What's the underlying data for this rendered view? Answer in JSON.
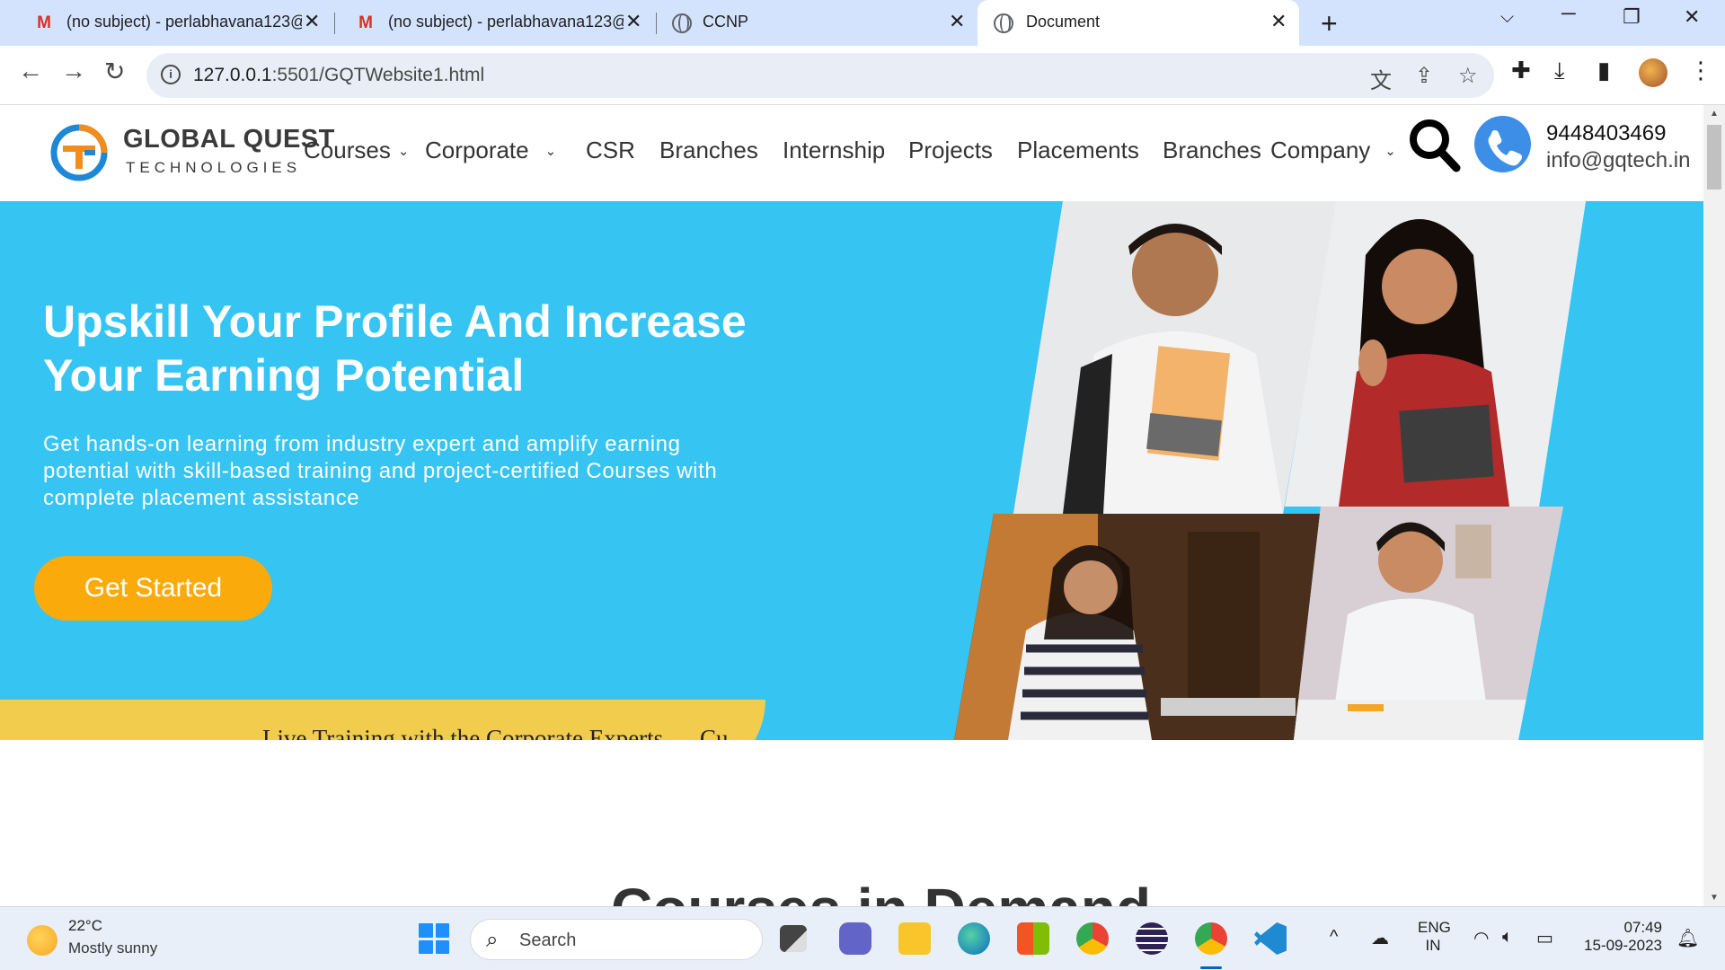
{
  "browser": {
    "tabs": [
      {
        "icon": "gmail-icon",
        "title": "(no subject) - perlabhavana123@",
        "active": false
      },
      {
        "icon": "gmail-icon",
        "title": "(no subject) - perlabhavana123@",
        "active": false
      },
      {
        "icon": "globe-icon",
        "title": "CCNP",
        "active": false
      },
      {
        "icon": "globe-icon",
        "title": "Document",
        "active": true
      }
    ],
    "url_host": "127.0.0.1",
    "url_path": ":5501/GQTWebsite1.html"
  },
  "site": {
    "logo_line1": "GLOBAL QUEST",
    "logo_line2": "TECHNOLOGIES",
    "nav": {
      "courses": "Courses",
      "corporate": "Corporate",
      "csr": "CSR",
      "branches": "Branches",
      "internship": "Internship",
      "projects": "Projects",
      "placements": "Placements",
      "branches2": "Branches",
      "company": "Company"
    },
    "phone": "9448403469",
    "email": "info@gqtech.in"
  },
  "hero": {
    "title_line1": "Upskill Your Profile And Increase",
    "title_line2": "Your Earning Potential",
    "subtitle": "Get hands-on learning from industry expert and amplify earning potential with skill-based training and project-certified Courses with complete placement assistance",
    "cta": "Get Started",
    "banner_text": "Live Training with the Corporate Experts",
    "banner_text2": "Cu"
  },
  "section": {
    "title": "Courses in Demand"
  },
  "taskbar": {
    "temperature": "22°C",
    "weather": "Mostly sunny",
    "search": "Search",
    "lang1": "ENG",
    "lang2": "IN",
    "time": "07:49",
    "date": "15-09-2023"
  },
  "colors": {
    "hero_bg": "#36c4f3",
    "cta": "#fbaa0c",
    "banner": "#f2cd4d",
    "tabbar": "#d3e3fd"
  }
}
